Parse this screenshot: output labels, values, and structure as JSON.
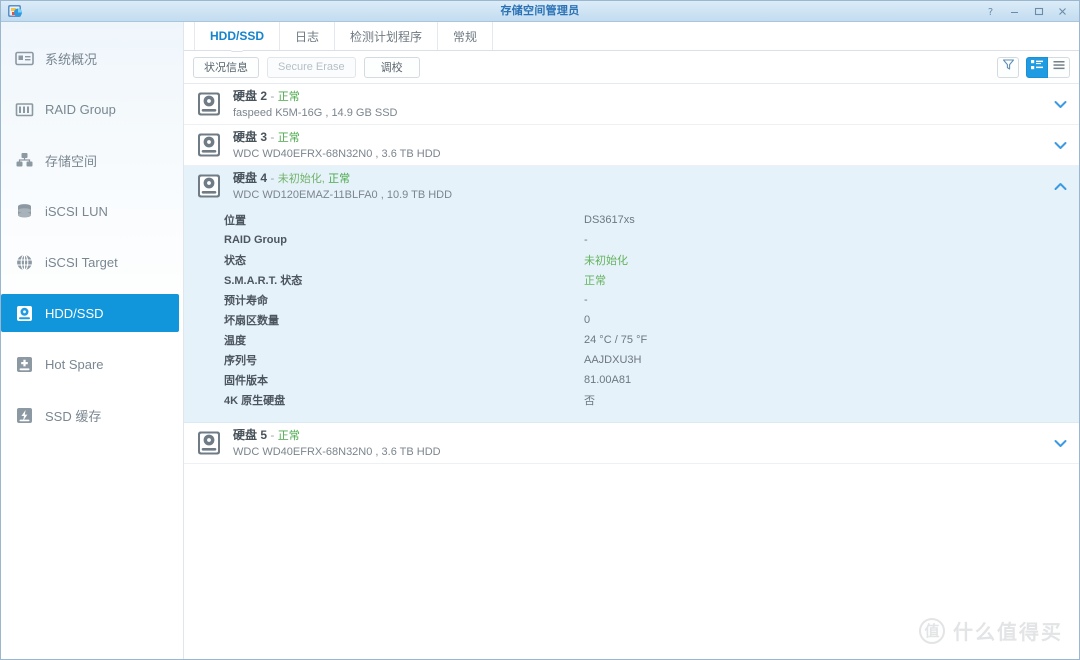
{
  "window": {
    "title": "存储空间管理员",
    "app_icon": "synology-storage-manager-icon",
    "controls": [
      {
        "name": "help-button",
        "glyph": "?"
      },
      {
        "name": "minimize-button",
        "glyph": "–"
      },
      {
        "name": "maximize-button",
        "glyph": "□"
      },
      {
        "name": "close-button",
        "glyph": "✕"
      }
    ]
  },
  "sidebar": {
    "items": [
      {
        "label": "系统概况",
        "icon": "overview-icon",
        "active": false
      },
      {
        "label": "RAID Group",
        "icon": "raid-group-icon",
        "active": false
      },
      {
        "label": "存储空间",
        "icon": "storage-pool-icon",
        "active": false
      },
      {
        "label": "iSCSI LUN",
        "icon": "iscsi-lun-icon",
        "active": false
      },
      {
        "label": "iSCSI Target",
        "icon": "iscsi-target-icon",
        "active": false
      },
      {
        "label": "HDD/SSD",
        "icon": "hdd-ssd-icon",
        "active": true
      },
      {
        "label": "Hot Spare",
        "icon": "hot-spare-icon",
        "active": false
      },
      {
        "label": "SSD 缓存",
        "icon": "ssd-cache-icon",
        "active": false
      }
    ]
  },
  "tabs": [
    {
      "label": "HDD/SSD",
      "active": true
    },
    {
      "label": "日志",
      "active": false
    },
    {
      "label": "检测计划程序",
      "active": false
    },
    {
      "label": "常规",
      "active": false
    }
  ],
  "toolbar": {
    "buttons": [
      {
        "label": "状况信息",
        "disabled": false
      },
      {
        "label": "Secure Erase",
        "disabled": true
      },
      {
        "label": "调校",
        "disabled": false
      }
    ],
    "right": [
      {
        "name": "filter-icon",
        "active": false
      },
      {
        "name": "list-detail-view-icon",
        "active": true
      },
      {
        "name": "list-view-icon",
        "active": false
      }
    ]
  },
  "disks": [
    {
      "name": "硬盘 2",
      "separator": "-",
      "status": "正常",
      "status_extra": "",
      "model": "faspeed K5M-16G , 14.9 GB SSD",
      "expanded": false
    },
    {
      "name": "硬盘 3",
      "separator": "-",
      "status": "正常",
      "status_extra": "",
      "model": "WDC WD40EFRX-68N32N0 , 3.6 TB HDD",
      "expanded": false
    },
    {
      "name": "硬盘 4",
      "separator": "-",
      "status": "正常",
      "status_extra": "未初始化,",
      "model": "WDC WD120EMAZ-11BLFA0 , 10.9 TB HDD",
      "expanded": true,
      "details": [
        {
          "label": "位置",
          "value": "DS3617xs",
          "highlight": false
        },
        {
          "label": "RAID Group",
          "value": "-",
          "highlight": false
        },
        {
          "label": "状态",
          "value": "未初始化",
          "highlight": true
        },
        {
          "label": "S.M.A.R.T. 状态",
          "value": "正常",
          "highlight": true
        },
        {
          "label": "预计寿命",
          "value": "-",
          "highlight": false
        },
        {
          "label": "坏扇区数量",
          "value": "0",
          "highlight": false
        },
        {
          "label": "温度",
          "value": "24 °C / 75 °F",
          "highlight": false
        },
        {
          "label": "序列号",
          "value": "AAJDXU3H",
          "highlight": false
        },
        {
          "label": "固件版本",
          "value": "81.00A81",
          "highlight": false
        },
        {
          "label": "4K 原生硬盘",
          "value": "否",
          "highlight": false
        }
      ]
    },
    {
      "name": "硬盘 5",
      "separator": "-",
      "status": "正常",
      "status_extra": "",
      "model": "WDC WD40EFRX-68N32N0 , 3.6 TB HDD",
      "expanded": false
    }
  ],
  "watermark": {
    "mark": "值",
    "text": "什么值得买"
  },
  "colors": {
    "accent": "#1296db",
    "tab_active": "#1583cd",
    "status_ok": "#4ba84b",
    "status_uninit": "#72b36a",
    "expanded_bg": "#e6f2fa"
  }
}
